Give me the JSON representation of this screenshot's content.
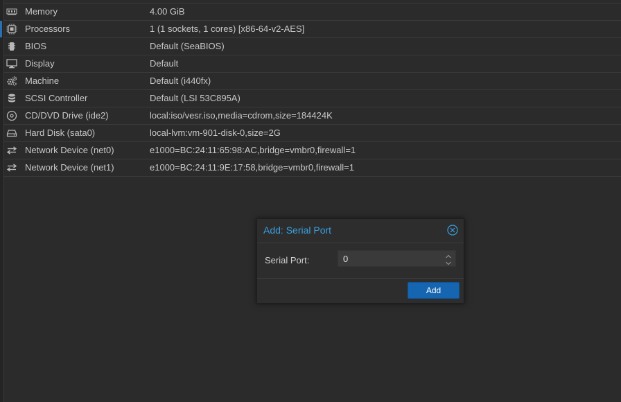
{
  "hardware": {
    "rows": [
      {
        "icon": "memory-icon",
        "key": "Memory",
        "value": "4.00 GiB"
      },
      {
        "icon": "cpu-icon",
        "key": "Processors",
        "value": "1 (1 sockets, 1 cores) [x86-64-v2-AES]"
      },
      {
        "icon": "bios-chip-icon",
        "key": "BIOS",
        "value": "Default (SeaBIOS)"
      },
      {
        "icon": "monitor-icon",
        "key": "Display",
        "value": "Default"
      },
      {
        "icon": "cogs-icon",
        "key": "Machine",
        "value": "Default (i440fx)"
      },
      {
        "icon": "database-icon",
        "key": "SCSI Controller",
        "value": "Default (LSI 53C895A)"
      },
      {
        "icon": "optical-disc-icon",
        "key": "CD/DVD Drive (ide2)",
        "value": "local:iso/vesr.iso,media=cdrom,size=184424K"
      },
      {
        "icon": "hard-disk-icon",
        "key": "Hard Disk (sata0)",
        "value": "local-lvm:vm-901-disk-0,size=2G"
      },
      {
        "icon": "exchange-icon",
        "key": "Network Device (net0)",
        "value": "e1000=BC:24:11:65:98:AC,bridge=vmbr0,firewall=1"
      },
      {
        "icon": "exchange-icon",
        "key": "Network Device (net1)",
        "value": "e1000=BC:24:11:9E:17:58,bridge=vmbr0,firewall=1"
      }
    ]
  },
  "dialog": {
    "title": "Add: Serial Port",
    "close_icon": "close-circle-icon",
    "field_label": "Serial Port:",
    "field_value": "0",
    "add_label": "Add"
  },
  "colors": {
    "background": "#2b2b2b",
    "dialog_title": "#3aa0e0",
    "primary_button": "#1565b0",
    "selection_marker": "#2a6fb0"
  }
}
